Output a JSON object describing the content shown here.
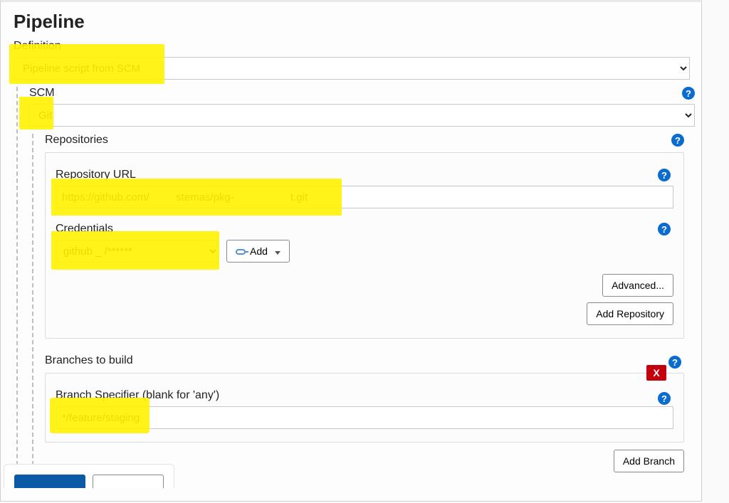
{
  "page": {
    "title": "Pipeline"
  },
  "definition": {
    "label": "Definition",
    "value": "Pipeline script from SCM"
  },
  "scm": {
    "label": "SCM",
    "value": "Git"
  },
  "repositories": {
    "label": "Repositories",
    "repo_url_label": "Repository URL",
    "repo_url_value": "https://github.com/         stemas/pkg-                   t.git",
    "credentials_label": "Credentials",
    "credentials_value": "github               _  /******",
    "add_button_label": "Add",
    "advanced_button_label": "Advanced...",
    "add_repo_button_label": "Add Repository"
  },
  "branches": {
    "label": "Branches to build",
    "specifier_label": "Branch Specifier (blank for 'any')",
    "specifier_value": "*/feature/staging",
    "add_branch_label": "Add Branch"
  },
  "footer": {
    "save_label": " ",
    "apply_label": " "
  },
  "help_char": "?"
}
